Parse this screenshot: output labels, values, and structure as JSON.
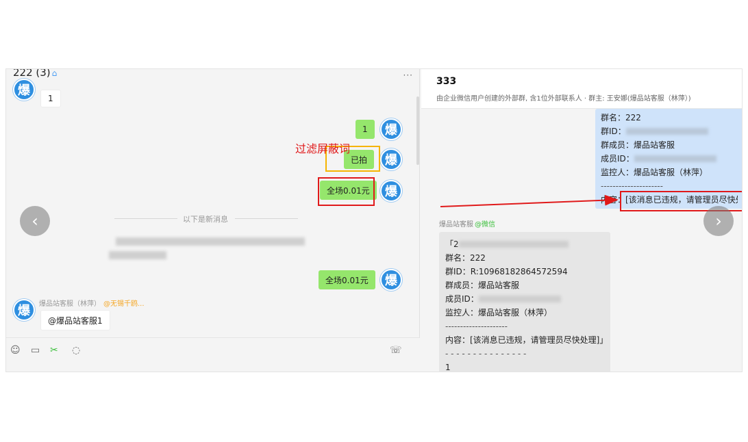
{
  "left_pane": {
    "title": "222 (3)",
    "more": "···",
    "messages": {
      "incoming_first": "1",
      "outgoing_1": "1",
      "outgoing_2": "已拍",
      "outgoing_3": "全场0.01元",
      "outgoing_4": "全场0.01元",
      "incoming_last": "@爆品站客服1"
    },
    "divider": "以下是新消息",
    "sender": {
      "name": "爆品站客服（林萍）",
      "tag": "@无锡千鸥..."
    },
    "avatar_char": "爆"
  },
  "annotation": {
    "label": "过滤屏蔽词"
  },
  "right_pane": {
    "title": "333",
    "subtitle": "由企业微信用户创建的外部群, 含1位外部联系人 · 群主: 王安娜(爆品站客服（林萍）)",
    "blue_card": {
      "group_name": "群名：222",
      "group_id": "群ID：",
      "member": "群成员：爆品站客服",
      "member_id": "成员ID：",
      "monitor": "监控人：爆品站客服（林萍）",
      "sep": "---------------------",
      "content": "内容：[该消息已违规，请管理员尽快处理]"
    },
    "sender": {
      "name": "爆品站客服",
      "tag": "@微信"
    },
    "gray_card": {
      "bracket": "「2",
      "group_name": "群名：222",
      "group_id": "群ID：R:10968182864572594",
      "member": "群成员：爆品站客服",
      "member_id": "成员ID：",
      "monitor": "监控人：爆品站客服（林萍）",
      "sep": "---------------------",
      "content": "内容：[该消息已违规，请管理员尽快处理]」",
      "sep2": "- - - - - - - - - - - - - - -",
      "tail": "1"
    }
  },
  "colors": {
    "green_bubble": "#95e66c",
    "avatar_blue": "#2f8fe0",
    "annot_red": "#e0191a",
    "annot_yellow": "#f5b400"
  },
  "icons": [
    "emoji-icon",
    "folder-icon",
    "scissors-icon",
    "chat-icon",
    "video-call-icon",
    "chevron-left-icon",
    "chevron-right-icon"
  ]
}
